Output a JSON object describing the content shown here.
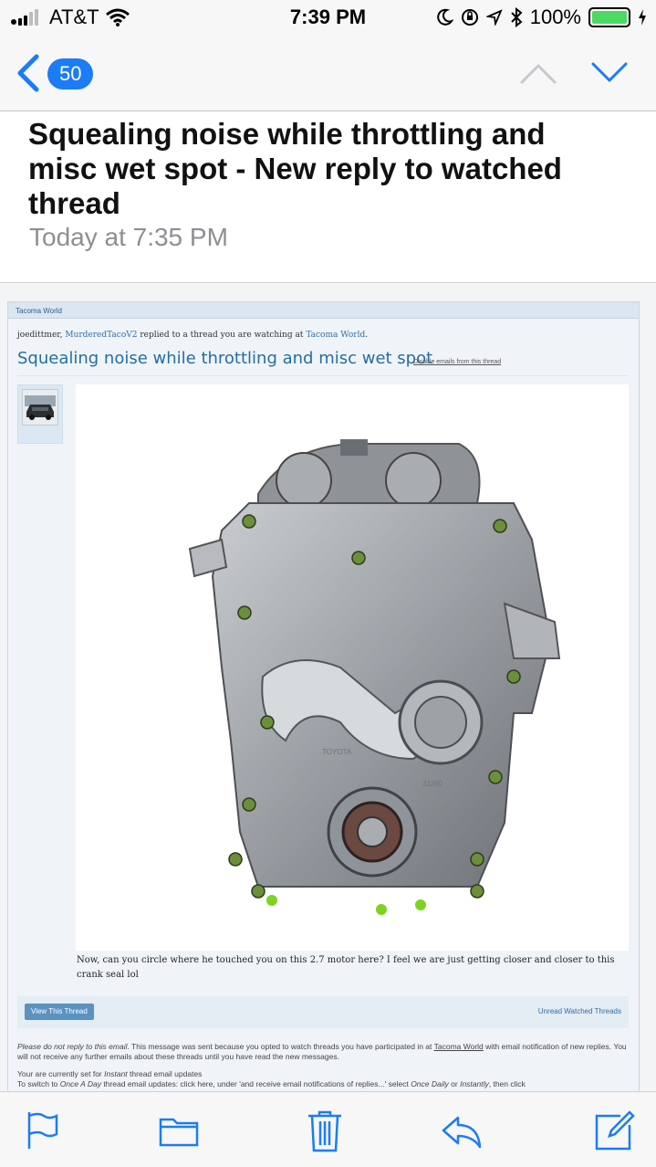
{
  "status_bar": {
    "carrier": "AT&T",
    "time": "7:39 PM",
    "battery": "100%",
    "battery_level": 1.0
  },
  "nav": {
    "back_count": "50"
  },
  "mail": {
    "subject": "Squealing noise while throttling and misc wet spot - New reply to watched thread",
    "date": "Today at 7:35 PM"
  },
  "email": {
    "brand": "Tacoma World",
    "notice_user1": "joedittmer,",
    "notice_user2": "MurderedTacoV2",
    "notice_mid": "replied to a thread you are watching at",
    "notice_site": "Tacoma World",
    "notice_end": ".",
    "thread_title": "Squealing noise while throttling and misc wet spot",
    "disable_link": "Disable emails from this thread",
    "post_text": "Now, can you circle where he touched you on this 2.7 motor here? I feel we are just getting closer and closer to this crank seal lol",
    "view_button": "View This Thread",
    "unread_link": "Unread Watched Threads",
    "footer_1a": "Please do not reply to this email",
    "footer_1b": ". This message was sent because you opted to watch threads you have participated in at",
    "footer_1c": "Tacoma World",
    "footer_1d": "with email notification of new replies. You will not receive any further emails about these threads until you have read the new messages.",
    "footer_2a": "Your are currently set for",
    "footer_2b": "Instant",
    "footer_2c": "thread email updates",
    "footer_3a": "To switch to",
    "footer_3b": "Once A Day",
    "footer_3c": "thread email updates: click here, under 'and receive email notifications of replies...' select",
    "footer_3d": "Once Daily",
    "footer_3e": "or",
    "footer_3f": "Instantly",
    "footer_3g": ", then click"
  },
  "image_label": {
    "engine_text1": "TOYOTA",
    "engine_text2": "31260"
  },
  "colors": {
    "ios_blue": "#1b7cf6",
    "tw_blue": "#236ea4",
    "bolt_green": "#7ed321"
  },
  "toolbar": {
    "icons": [
      "flag-icon",
      "folder-icon",
      "trash-icon",
      "reply-icon",
      "compose-icon"
    ]
  }
}
